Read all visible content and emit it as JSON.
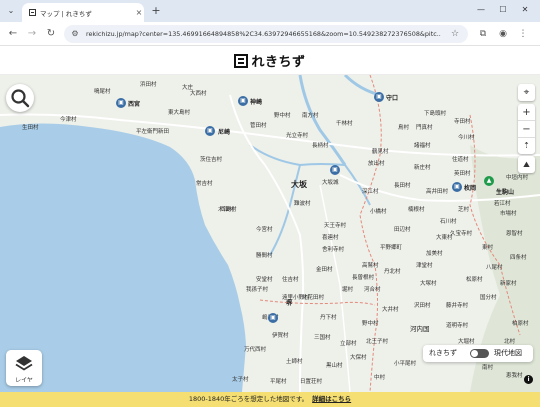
{
  "browser": {
    "tab_title": "マップ | れきちず",
    "tab_close": "×",
    "new_tab": "+",
    "url": "rekichizu.jp/map?center=135.46991664894858%2C34.63972946655168&zoom=10.549238272376508&pitc...",
    "minimize": "—",
    "maximize": "☐",
    "close": "✕"
  },
  "site": {
    "logo_text": "れきちず"
  },
  "map": {
    "labels": [
      {
        "t": "西宮",
        "k": "sta"
      },
      {
        "t": "尼崎",
        "k": "sta"
      },
      {
        "t": "神崎",
        "k": "sta"
      },
      {
        "t": "守口",
        "k": "sta"
      },
      {
        "t": "大坂",
        "k": "big"
      },
      {
        "t": "堺",
        "k": "sta"
      },
      {
        "t": "枚岡",
        "k": "sta"
      },
      {
        "t": "生駒山",
        "k": "sta"
      },
      {
        "t": "河内国",
        "k": "mid"
      },
      {
        "t": "大坂城",
        "k": "lbl"
      },
      {
        "t": "鳴尾村",
        "k": "lbl"
      },
      {
        "t": "浜田村",
        "k": "lbl"
      },
      {
        "t": "今津村",
        "k": "lbl"
      },
      {
        "t": "東大島村",
        "k": "lbl"
      },
      {
        "t": "大西村",
        "k": "lbl"
      },
      {
        "t": "野中村",
        "k": "lbl"
      },
      {
        "t": "南方村",
        "k": "lbl"
      },
      {
        "t": "光立寺村",
        "k": "lbl"
      },
      {
        "t": "長柄村",
        "k": "lbl"
      },
      {
        "t": "茨住吉村",
        "k": "lbl"
      },
      {
        "t": "平左衛門新田",
        "k": "lbl"
      },
      {
        "t": "常吉村",
        "k": "lbl"
      },
      {
        "t": "生田村",
        "k": "lbl"
      },
      {
        "t": "西島村",
        "k": "lbl"
      },
      {
        "t": "大庄",
        "k": "lbl"
      },
      {
        "t": "菅田村",
        "k": "lbl"
      },
      {
        "t": "千林村",
        "k": "lbl"
      },
      {
        "t": "鶴見村",
        "k": "lbl"
      },
      {
        "t": "放出村",
        "k": "lbl"
      },
      {
        "t": "門真村",
        "k": "lbl"
      },
      {
        "t": "下島頭村",
        "k": "lbl"
      },
      {
        "t": "鳥村",
        "k": "lbl"
      },
      {
        "t": "寺田村",
        "k": "lbl"
      },
      {
        "t": "諸福村",
        "k": "lbl"
      },
      {
        "t": "新庄村",
        "k": "lbl"
      },
      {
        "t": "今川村",
        "k": "lbl"
      },
      {
        "t": "住道村",
        "k": "lbl"
      },
      {
        "t": "長田村",
        "k": "lbl"
      },
      {
        "t": "深江村",
        "k": "lbl"
      },
      {
        "t": "高井田村",
        "k": "lbl"
      },
      {
        "t": "楠根村",
        "k": "lbl"
      },
      {
        "t": "芝村",
        "k": "lbl"
      },
      {
        "t": "市場村",
        "k": "lbl"
      },
      {
        "t": "難波村",
        "k": "lbl"
      },
      {
        "t": "今宮村",
        "k": "lbl"
      },
      {
        "t": "木津村",
        "k": "lbl"
      },
      {
        "t": "勝間村",
        "k": "lbl"
      },
      {
        "t": "天王寺村",
        "k": "lbl"
      },
      {
        "t": "小橋村",
        "k": "lbl"
      },
      {
        "t": "舎利寺村",
        "k": "lbl"
      },
      {
        "t": "田辺村",
        "k": "lbl"
      },
      {
        "t": "喜連村",
        "k": "lbl"
      },
      {
        "t": "平野郷町",
        "k": "lbl"
      },
      {
        "t": "加美村",
        "k": "lbl"
      },
      {
        "t": "久宝寺村",
        "k": "lbl"
      },
      {
        "t": "八尾村",
        "k": "lbl"
      },
      {
        "t": "恩智村",
        "k": "lbl"
      },
      {
        "t": "安堂村",
        "k": "lbl"
      },
      {
        "t": "住吉村",
        "k": "lbl"
      },
      {
        "t": "我孫子村",
        "k": "lbl"
      },
      {
        "t": "遠里小野村",
        "k": "lbl"
      },
      {
        "t": "北花田村",
        "k": "lbl"
      },
      {
        "t": "金田村",
        "k": "lbl"
      },
      {
        "t": "長曽根村",
        "k": "lbl"
      },
      {
        "t": "堀村",
        "k": "lbl"
      },
      {
        "t": "河合村",
        "k": "lbl"
      },
      {
        "t": "丹北村",
        "k": "lbl"
      },
      {
        "t": "大塚村",
        "k": "lbl"
      },
      {
        "t": "藤井寺村",
        "k": "lbl"
      },
      {
        "t": "道明寺村",
        "k": "lbl"
      },
      {
        "t": "国分村",
        "k": "lbl"
      },
      {
        "t": "柏原村",
        "k": "lbl"
      },
      {
        "t": "太子村",
        "k": "lbl"
      },
      {
        "t": "平尾村",
        "k": "lbl"
      },
      {
        "t": "土師村",
        "k": "lbl"
      },
      {
        "t": "万代西村",
        "k": "lbl"
      },
      {
        "t": "三国村",
        "k": "lbl"
      },
      {
        "t": "黒山村",
        "k": "lbl"
      },
      {
        "t": "日置荘村",
        "k": "lbl"
      },
      {
        "t": "大保村",
        "k": "lbl"
      },
      {
        "t": "北王子村",
        "k": "lbl"
      },
      {
        "t": "立部村",
        "k": "lbl"
      },
      {
        "t": "中村",
        "k": "lbl"
      },
      {
        "t": "小平尾村",
        "k": "lbl"
      },
      {
        "t": "丹下村",
        "k": "lbl"
      },
      {
        "t": "嶋泉村",
        "k": "lbl"
      },
      {
        "t": "伊賀村",
        "k": "lbl"
      },
      {
        "t": "大井村",
        "k": "lbl"
      },
      {
        "t": "野中村",
        "k": "lbl"
      },
      {
        "t": "沢田村",
        "k": "lbl"
      },
      {
        "t": "津堂村",
        "k": "lbl"
      },
      {
        "t": "高鷲村",
        "k": "lbl"
      },
      {
        "t": "松原村",
        "k": "lbl"
      },
      {
        "t": "大堀村",
        "k": "lbl"
      },
      {
        "t": "新家村",
        "k": "lbl"
      },
      {
        "t": "北村",
        "k": "lbl"
      },
      {
        "t": "東村",
        "k": "lbl"
      },
      {
        "t": "南村",
        "k": "lbl"
      },
      {
        "t": "恵我村",
        "k": "lbl"
      },
      {
        "t": "石川村",
        "k": "lbl"
      },
      {
        "t": "若江村",
        "k": "lbl"
      },
      {
        "t": "英田村",
        "k": "lbl"
      },
      {
        "t": "中垣内村",
        "k": "lbl"
      },
      {
        "t": "大東村",
        "k": "lbl"
      },
      {
        "t": "四条村",
        "k": "lbl"
      },
      {
        "t": "南野村",
        "k": "lbl"
      }
    ]
  },
  "controls": {
    "zoom_in": "+",
    "zoom_out": "−",
    "layer_label": "レイヤ",
    "toggle_left": "れきちず",
    "toggle_right": "現代地図",
    "info": "i"
  },
  "notice": {
    "text": "1800-1840年ごろを想定した地図です。",
    "link": "詳細はこちら"
  }
}
